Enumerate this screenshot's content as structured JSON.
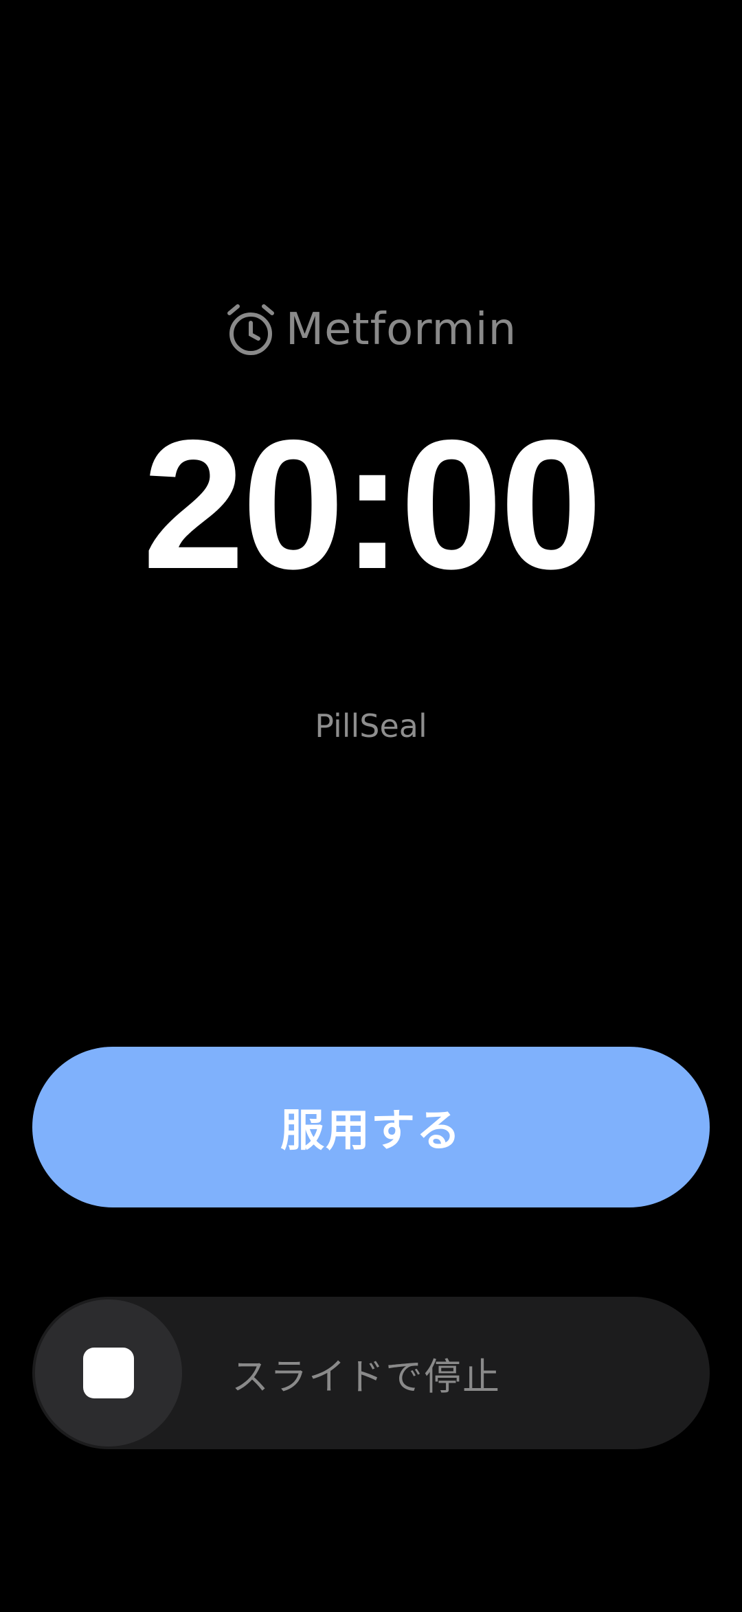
{
  "alarm": {
    "icon": "alarm-clock-icon",
    "medication_name": "Metformin",
    "time": "20:00",
    "app_name": "PillSeal"
  },
  "actions": {
    "take_label": "服用する",
    "slide_to_stop_label": "スライドで停止",
    "stop_icon": "stop-square-icon"
  },
  "colors": {
    "background": "#000000",
    "primary_button": "#7fb1fc",
    "slider_track": "#1c1c1d",
    "slider_thumb": "#2c2c2e",
    "muted_text": "#8a8a8a"
  }
}
